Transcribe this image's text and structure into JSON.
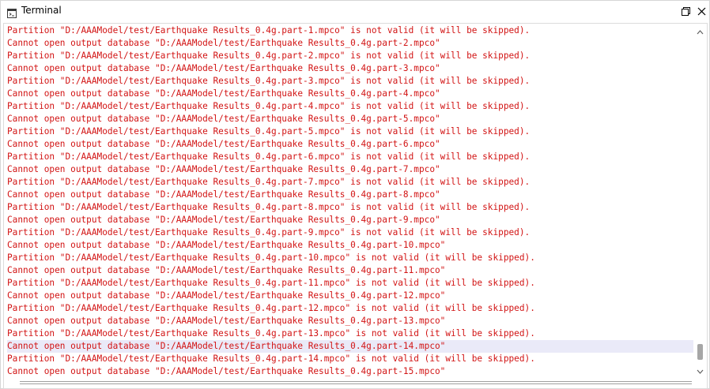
{
  "window": {
    "title": "Terminal",
    "title_icon": "terminal-icon",
    "restore_icon": "restore-icon",
    "close_icon": "close-icon"
  },
  "terminal": {
    "text_color": "#d21414",
    "highlight_color": "#eaeaf8",
    "highlighted_line": 25,
    "lines": [
      "Partition \"D:/AAAModel/test/Earthquake Results_0.4g.part-1.mpco\" is not valid (it will be skipped).",
      "Cannot open output database \"D:/AAAModel/test/Earthquake Results_0.4g.part-2.mpco\"",
      "Partition \"D:/AAAModel/test/Earthquake Results_0.4g.part-2.mpco\" is not valid (it will be skipped).",
      "Cannot open output database \"D:/AAAModel/test/Earthquake Results_0.4g.part-3.mpco\"",
      "Partition \"D:/AAAModel/test/Earthquake Results_0.4g.part-3.mpco\" is not valid (it will be skipped).",
      "Cannot open output database \"D:/AAAModel/test/Earthquake Results_0.4g.part-4.mpco\"",
      "Partition \"D:/AAAModel/test/Earthquake Results_0.4g.part-4.mpco\" is not valid (it will be skipped).",
      "Cannot open output database \"D:/AAAModel/test/Earthquake Results_0.4g.part-5.mpco\"",
      "Partition \"D:/AAAModel/test/Earthquake Results_0.4g.part-5.mpco\" is not valid (it will be skipped).",
      "Cannot open output database \"D:/AAAModel/test/Earthquake Results_0.4g.part-6.mpco\"",
      "Partition \"D:/AAAModel/test/Earthquake Results_0.4g.part-6.mpco\" is not valid (it will be skipped).",
      "Cannot open output database \"D:/AAAModel/test/Earthquake Results_0.4g.part-7.mpco\"",
      "Partition \"D:/AAAModel/test/Earthquake Results_0.4g.part-7.mpco\" is not valid (it will be skipped).",
      "Cannot open output database \"D:/AAAModel/test/Earthquake Results_0.4g.part-8.mpco\"",
      "Partition \"D:/AAAModel/test/Earthquake Results_0.4g.part-8.mpco\" is not valid (it will be skipped).",
      "Cannot open output database \"D:/AAAModel/test/Earthquake Results_0.4g.part-9.mpco\"",
      "Partition \"D:/AAAModel/test/Earthquake Results_0.4g.part-9.mpco\" is not valid (it will be skipped).",
      "Cannot open output database \"D:/AAAModel/test/Earthquake Results_0.4g.part-10.mpco\"",
      "Partition \"D:/AAAModel/test/Earthquake Results_0.4g.part-10.mpco\" is not valid (it will be skipped).",
      "Cannot open output database \"D:/AAAModel/test/Earthquake Results_0.4g.part-11.mpco\"",
      "Partition \"D:/AAAModel/test/Earthquake Results_0.4g.part-11.mpco\" is not valid (it will be skipped).",
      "Cannot open output database \"D:/AAAModel/test/Earthquake Results_0.4g.part-12.mpco\"",
      "Partition \"D:/AAAModel/test/Earthquake Results_0.4g.part-12.mpco\" is not valid (it will be skipped).",
      "Cannot open output database \"D:/AAAModel/test/Earthquake Results_0.4g.part-13.mpco\"",
      "Partition \"D:/AAAModel/test/Earthquake Results_0.4g.part-13.mpco\" is not valid (it will be skipped).",
      "Cannot open output database \"D:/AAAModel/test/Earthquake Results_0.4g.part-14.mpco\"",
      "Partition \"D:/AAAModel/test/Earthquake Results_0.4g.part-14.mpco\" is not valid (it will be skipped).",
      "Cannot open output database \"D:/AAAModel/test/Earthquake Results_0.4g.part-15.mpco\""
    ]
  },
  "scrollbars": {
    "up_icon": "arrow-up-icon",
    "down_icon": "arrow-down-icon"
  }
}
